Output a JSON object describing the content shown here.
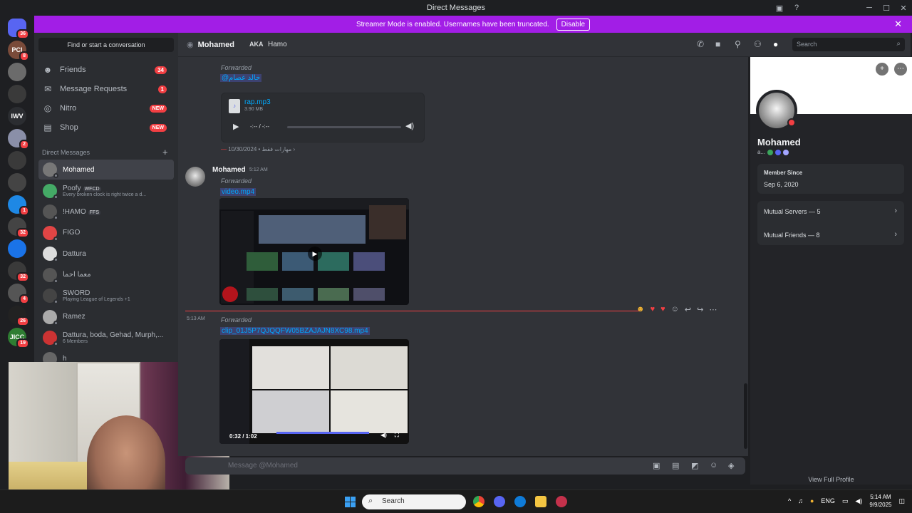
{
  "window": {
    "title": "Direct Messages"
  },
  "banner": {
    "text": "Streamer Mode is enabled. Usernames have been truncated.",
    "disable_label": "Disable"
  },
  "servers": [
    {
      "label": "",
      "badge": "36"
    },
    {
      "label": "PCI",
      "badge": "8"
    },
    {
      "label": "",
      "badge": ""
    },
    {
      "label": "",
      "badge": ""
    },
    {
      "label": "IWV",
      "badge": ""
    },
    {
      "label": "",
      "badge": "2"
    },
    {
      "label": "",
      "badge": ""
    },
    {
      "label": "",
      "badge": ""
    },
    {
      "label": "",
      "badge": "1"
    },
    {
      "label": "",
      "badge": "32"
    },
    {
      "label": "",
      "badge": ""
    },
    {
      "label": "",
      "badge": "32"
    },
    {
      "label": "",
      "badge": "4"
    },
    {
      "label": "",
      "badge": "26"
    },
    {
      "label": "JICC",
      "badge": "19"
    }
  ],
  "sidebar": {
    "find_placeholder": "Find or start a conversation",
    "nav": [
      {
        "label": "Friends",
        "count": "34",
        "icon": "friends-icon"
      },
      {
        "label": "Message Requests",
        "count": "1",
        "icon": "mail-icon"
      },
      {
        "label": "Nitro",
        "new": "NEW",
        "icon": "nitro-icon"
      },
      {
        "label": "Shop",
        "new": "NEW",
        "icon": "shop-icon"
      }
    ],
    "dm_header": "Direct Messages",
    "dms": [
      {
        "name": "Mohamed",
        "sub": "",
        "tag": ""
      },
      {
        "name": "Poofy",
        "sub": "Every broken clock is right twice a d...",
        "tag": "WFCD"
      },
      {
        "name": "!HAMO",
        "sub": "",
        "tag": "FFS"
      },
      {
        "name": "FIGO",
        "sub": "",
        "tag": ""
      },
      {
        "name": "Dattura",
        "sub": "",
        "tag": ""
      },
      {
        "name": "معما احما",
        "sub": "",
        "tag": ""
      },
      {
        "name": "SWORD",
        "sub": "Playing League of Legends +1",
        "tag": ""
      },
      {
        "name": "Ramez",
        "sub": "",
        "tag": ""
      },
      {
        "name": "Dattura, boda, Gehad, Murph,...",
        "sub": "6 Members",
        "tag": ""
      },
      {
        "name": "h",
        "sub": "",
        "tag": ""
      }
    ]
  },
  "chat_header": {
    "name": "Mohamed",
    "aka_label": "AKA",
    "aka_name": "Hamo",
    "search_placeholder": "Search"
  },
  "messages": {
    "forwarded_label": "Forwarded",
    "msg1": {
      "mention": "@خالد عصام",
      "file_name": "rap.mp3",
      "file_size": "3.90 MB",
      "time_display": "-:-- / -:--",
      "date": "10/30/2024",
      "date_suffix": "مهارات فقط"
    },
    "msg2": {
      "author": "Mohamed",
      "time": "5:12 AM",
      "link": "video.mp4"
    },
    "msg3": {
      "time": "5:13 AM",
      "link": "clip_01J5P7QJQQFW05BZAJAJN8XC98.mp4",
      "video_time": "0:32 / 1:02"
    }
  },
  "composer": {
    "placeholder": "Message @Mohamed"
  },
  "profile": {
    "name": "Mohamed",
    "badge_prefix": "a...",
    "member_since_label": "Member Since",
    "member_since": "Sep 6, 2020",
    "mutual_servers": "Mutual Servers — 5",
    "mutual_friends": "Mutual Friends — 8",
    "view_full": "View Full Profile"
  },
  "taskbar": {
    "search_placeholder": "Search",
    "lang": "ENG",
    "time": "5:14 AM",
    "date": "9/9/2025"
  },
  "colors": {
    "banner": "#a21ee6",
    "accent": "#5865f2",
    "danger": "#f23f43",
    "link": "#00a8fc"
  }
}
